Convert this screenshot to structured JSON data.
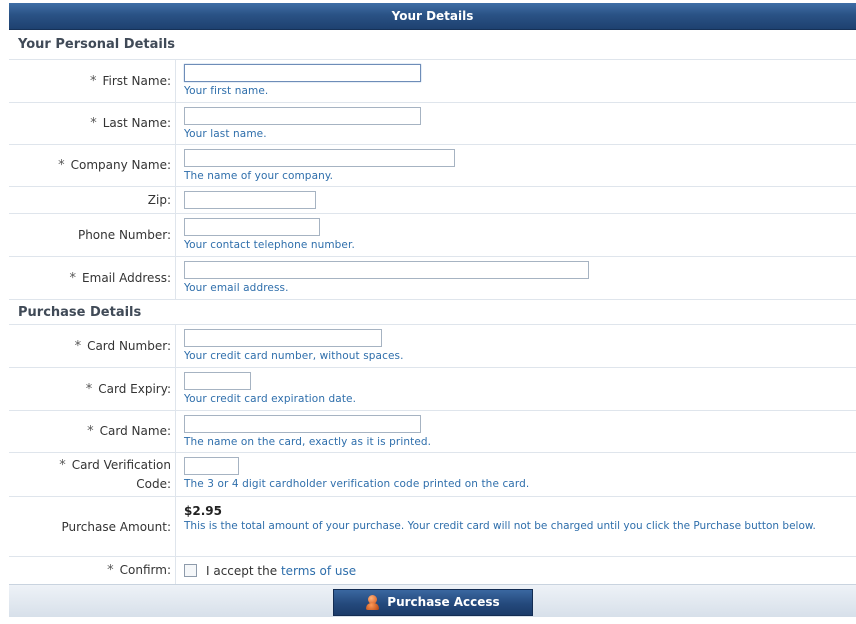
{
  "title": "Your Details",
  "personal": {
    "header": "Your Personal Details",
    "fields": {
      "first_name": {
        "label": "First Name:",
        "hint": "Your first name.",
        "value": ""
      },
      "last_name": {
        "label": "Last Name:",
        "hint": "Your last name.",
        "value": ""
      },
      "company": {
        "label": "Company Name:",
        "hint": "The name of your company.",
        "value": ""
      },
      "zip": {
        "label": "Zip:",
        "value": ""
      },
      "phone": {
        "label": "Phone Number:",
        "hint": "Your contact telephone number.",
        "value": ""
      },
      "email": {
        "label": "Email Address:",
        "hint": "Your email address.",
        "value": ""
      }
    }
  },
  "purchase": {
    "header": "Purchase Details",
    "fields": {
      "card_number": {
        "label": "Card Number:",
        "hint": "Your credit card number, without spaces.",
        "value": ""
      },
      "card_expiry": {
        "label": "Card Expiry:",
        "hint": "Your credit card expiration date.",
        "value": ""
      },
      "card_name": {
        "label": "Card Name:",
        "hint": "The name on the card, exactly as it is printed.",
        "value": ""
      },
      "cvc": {
        "label_line1": "Card Verification",
        "label_line2": "Code:",
        "hint": "The 3 or 4 digit cardholder verification code printed on the card.",
        "value": ""
      }
    },
    "amount": {
      "label": "Purchase Amount:",
      "value": "$2.95",
      "description": "This is the total amount of your purchase. Your credit card will not be charged until you click the Purchase button below."
    },
    "confirm": {
      "label": "Confirm:",
      "text": "I accept the",
      "link": "terms of use",
      "checked": false
    }
  },
  "required_marker": "*",
  "button": {
    "label": "Purchase Access",
    "icon": "user-icon"
  },
  "colors": {
    "title_bar": "#2a5285",
    "hint_text": "#2e6eab",
    "button": "#24497c"
  }
}
